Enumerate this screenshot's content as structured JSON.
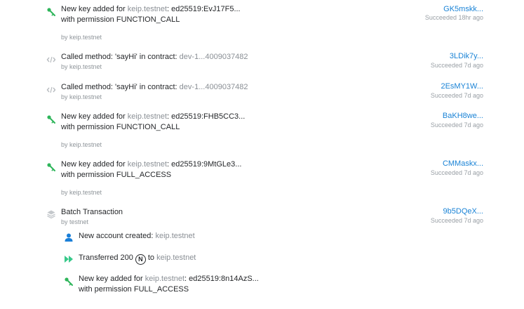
{
  "rows": [
    {
      "kind": "add_key",
      "prefix": "New key added for ",
      "account": "keip.testnet",
      "suffix": ": ed25519:EvJ17F5...",
      "line2": "with permission FUNCTION_CALL",
      "by": "by keip.testnet",
      "hash": "GK5mskk...",
      "status": "Succeeded 18hr ago"
    },
    {
      "kind": "call",
      "prefix": "Called method: 'sayHi' in contract: ",
      "contract": "dev-1...4009037482",
      "by": "by keip.testnet",
      "hash": "3LDik7y...",
      "status": "Succeeded 7d ago"
    },
    {
      "kind": "call",
      "prefix": "Called method: 'sayHi' in contract: ",
      "contract": "dev-1...4009037482",
      "by": "by keip.testnet",
      "hash": "2EsMY1W...",
      "status": "Succeeded 7d ago"
    },
    {
      "kind": "add_key",
      "prefix": "New key added for ",
      "account": "keip.testnet",
      "suffix": ": ed25519:FHB5CC3...",
      "line2": "with permission FUNCTION_CALL",
      "by": "by keip.testnet",
      "hash": "BaKH8we...",
      "status": "Succeeded 7d ago"
    },
    {
      "kind": "add_key",
      "prefix": "New key added for ",
      "account": "keip.testnet",
      "suffix": ": ed25519:9MtGLe3...",
      "line2": "with permission FULL_ACCESS",
      "by": "by keip.testnet",
      "hash": "CMMaskx...",
      "status": "Succeeded 7d ago"
    }
  ],
  "batch": {
    "title": "Batch Transaction",
    "by": "by testnet",
    "hash": "9b5DQeX...",
    "status": "Succeeded 7d ago",
    "actions": {
      "create": {
        "prefix": "New account created: ",
        "account": "keip.testnet"
      },
      "transfer": {
        "prefix": "Transferred 200",
        "badge": "N",
        "to": "to",
        "account": "keip.testnet"
      },
      "add_key": {
        "prefix": "New key added for ",
        "account": "keip.testnet",
        "suffix": ": ed25519:8n14AzS...",
        "line2": "with permission FULL_ACCESS"
      }
    }
  },
  "icons": {
    "key": "key-icon",
    "code": "code-icon",
    "batch": "layers-icon",
    "user": "user-icon",
    "transfer": "double-chevron-right-icon"
  },
  "colors": {
    "key_green": "#2eb55a",
    "transfer_green": "#37c98a",
    "user_blue": "#1a7fd8",
    "link_blue": "#1a83d6"
  }
}
